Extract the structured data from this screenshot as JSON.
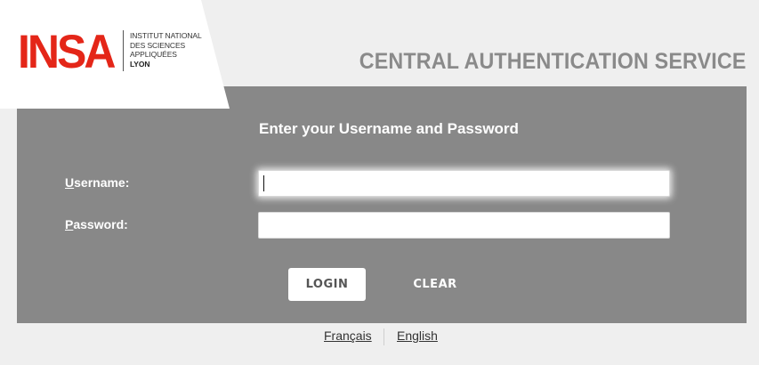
{
  "brand": {
    "logo_mark": "INSA",
    "logo_lines": [
      "INSTITUT NATIONAL",
      "DES SCIENCES",
      "APPLIQUÉES",
      "LYON"
    ],
    "accent_color": "#e42618"
  },
  "header": {
    "title": "CENTRAL AUTHENTICATION SERVICE"
  },
  "login": {
    "heading": "Enter your Username and Password",
    "username": {
      "label_first": "U",
      "label_rest": "sername:",
      "value": "",
      "placeholder": ""
    },
    "password": {
      "label_first": "P",
      "label_rest": "assword:",
      "value": "",
      "placeholder": ""
    },
    "login_label": "LOGIN",
    "clear_label": "CLEAR",
    "panel_color": "#888888"
  },
  "languages": [
    {
      "label": "Français"
    },
    {
      "label": "English"
    }
  ]
}
